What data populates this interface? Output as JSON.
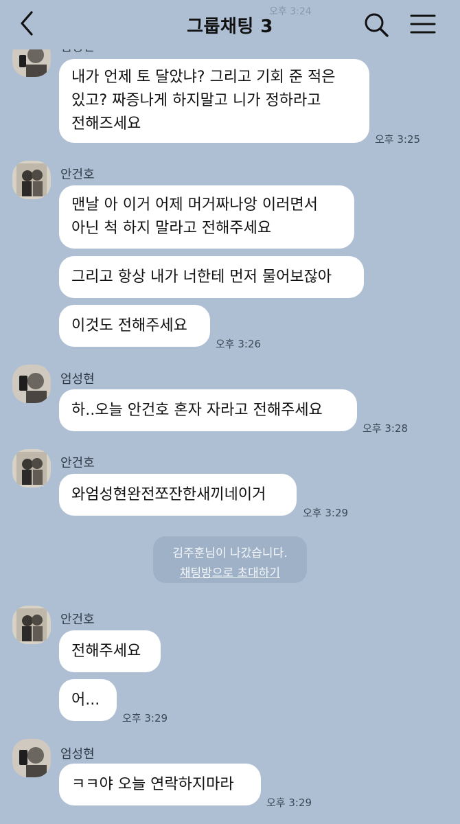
{
  "header": {
    "title": "그룹채팅 3",
    "ghost_time": "오후 3:24"
  },
  "messages": [
    {
      "sender": "엄성현",
      "lines": [
        "내가 언제 토 달았냐? 그리고 기회 준 적은\n있고? 짜증나게 하지말고 니가 정하라고\n전해즈세요"
      ],
      "time": "오후 3:25"
    },
    {
      "sender": "안건호",
      "lines": [
        "맨날 아 이거 어제 머거짜나앙 이러면서\n아닌 척 하지 말라고 전해주세요",
        "그리고 항상 내가 너한테 먼저 물어보잖아",
        "이것도 전해주세요"
      ],
      "time": "오후 3:26"
    },
    {
      "sender": "엄성현",
      "lines": [
        "하..오늘 안건호 혼자 자라고 전해주세요"
      ],
      "time": "오후 3:28"
    },
    {
      "sender": "안건호",
      "lines": [
        "와엄성현완전쪼잔한새끼네이거"
      ],
      "time": "오후 3:29"
    },
    {
      "sender": "안건호",
      "lines": [
        "전해주세요",
        "어..."
      ],
      "time": "오후 3:29"
    },
    {
      "sender": "엄성현",
      "lines": [
        "ㅋㅋ야 오늘 연락하지마라"
      ],
      "time": "오후 3:29"
    }
  ],
  "system_notice": {
    "text": "김주훈님이 나갔습니다.",
    "link": "채팅방으로 초대하기"
  },
  "colors": {
    "background": "#aebfd3",
    "bubble": "#ffffff",
    "system_bg": "#9fb1c6"
  }
}
